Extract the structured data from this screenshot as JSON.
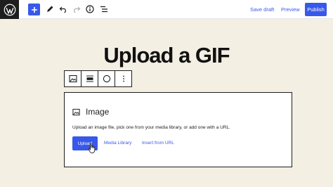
{
  "header": {
    "save_draft": "Save draft",
    "preview": "Preview",
    "publish": "Publish",
    "icons": [
      "wordpress-logo",
      "plus-icon",
      "pencil-icon",
      "undo-icon",
      "redo-icon",
      "info-icon",
      "list-view-icon"
    ]
  },
  "post": {
    "title": "Upload a GIF"
  },
  "block_toolbar": {
    "icons": [
      "image-icon",
      "align-icon",
      "circle-icon",
      "more-vertical-icon"
    ]
  },
  "image_block": {
    "label": "Image",
    "instructions": "Upload an image file, pick one from your media library, or add one with a URL.",
    "upload_label": "Upload",
    "media_library_label": "Media Library",
    "insert_url_label": "Insert from URL"
  },
  "colors": {
    "accent": "#3858e9",
    "background": "#f4efe3",
    "dark": "#1e1e1e"
  }
}
